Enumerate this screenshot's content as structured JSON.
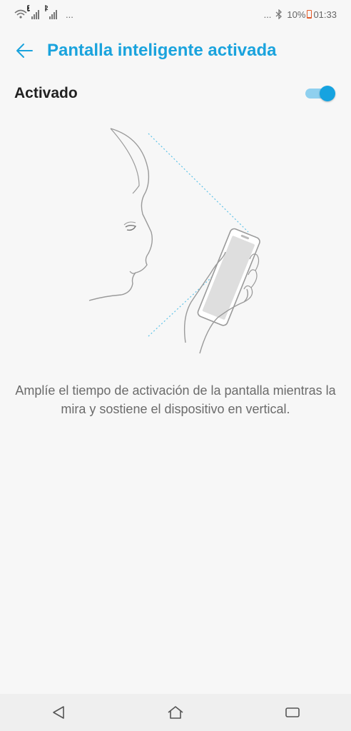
{
  "status_bar": {
    "sim1_badge": "1",
    "sim2_badge": "2",
    "more_indicator": "...",
    "right_more": "...",
    "battery": "10%",
    "time": "01:33",
    "icons": [
      "wifi-icon",
      "signal-sim1-icon",
      "signal-sim2-icon",
      "bluetooth-icon",
      "battery-icon"
    ]
  },
  "header": {
    "title": "Pantalla inteligente activada",
    "back_icon": "arrow-left-icon"
  },
  "setting": {
    "label": "Activado",
    "enabled": true
  },
  "illustration": {
    "icon": "face-holding-phone-illustration"
  },
  "description": "Amplíe el tiempo de activación de la pantalla mientras la mira y sostiene el dispositivo en vertical.",
  "nav": {
    "icons": [
      "nav-back-icon",
      "nav-home-icon",
      "nav-recents-icon"
    ]
  },
  "colors": {
    "accent": "#1aa3dd",
    "toggle_track": "#8fd0ef",
    "toggle_knob": "#16a3e0",
    "background": "#f7f7f7",
    "battery_low": "#e05a2a"
  }
}
